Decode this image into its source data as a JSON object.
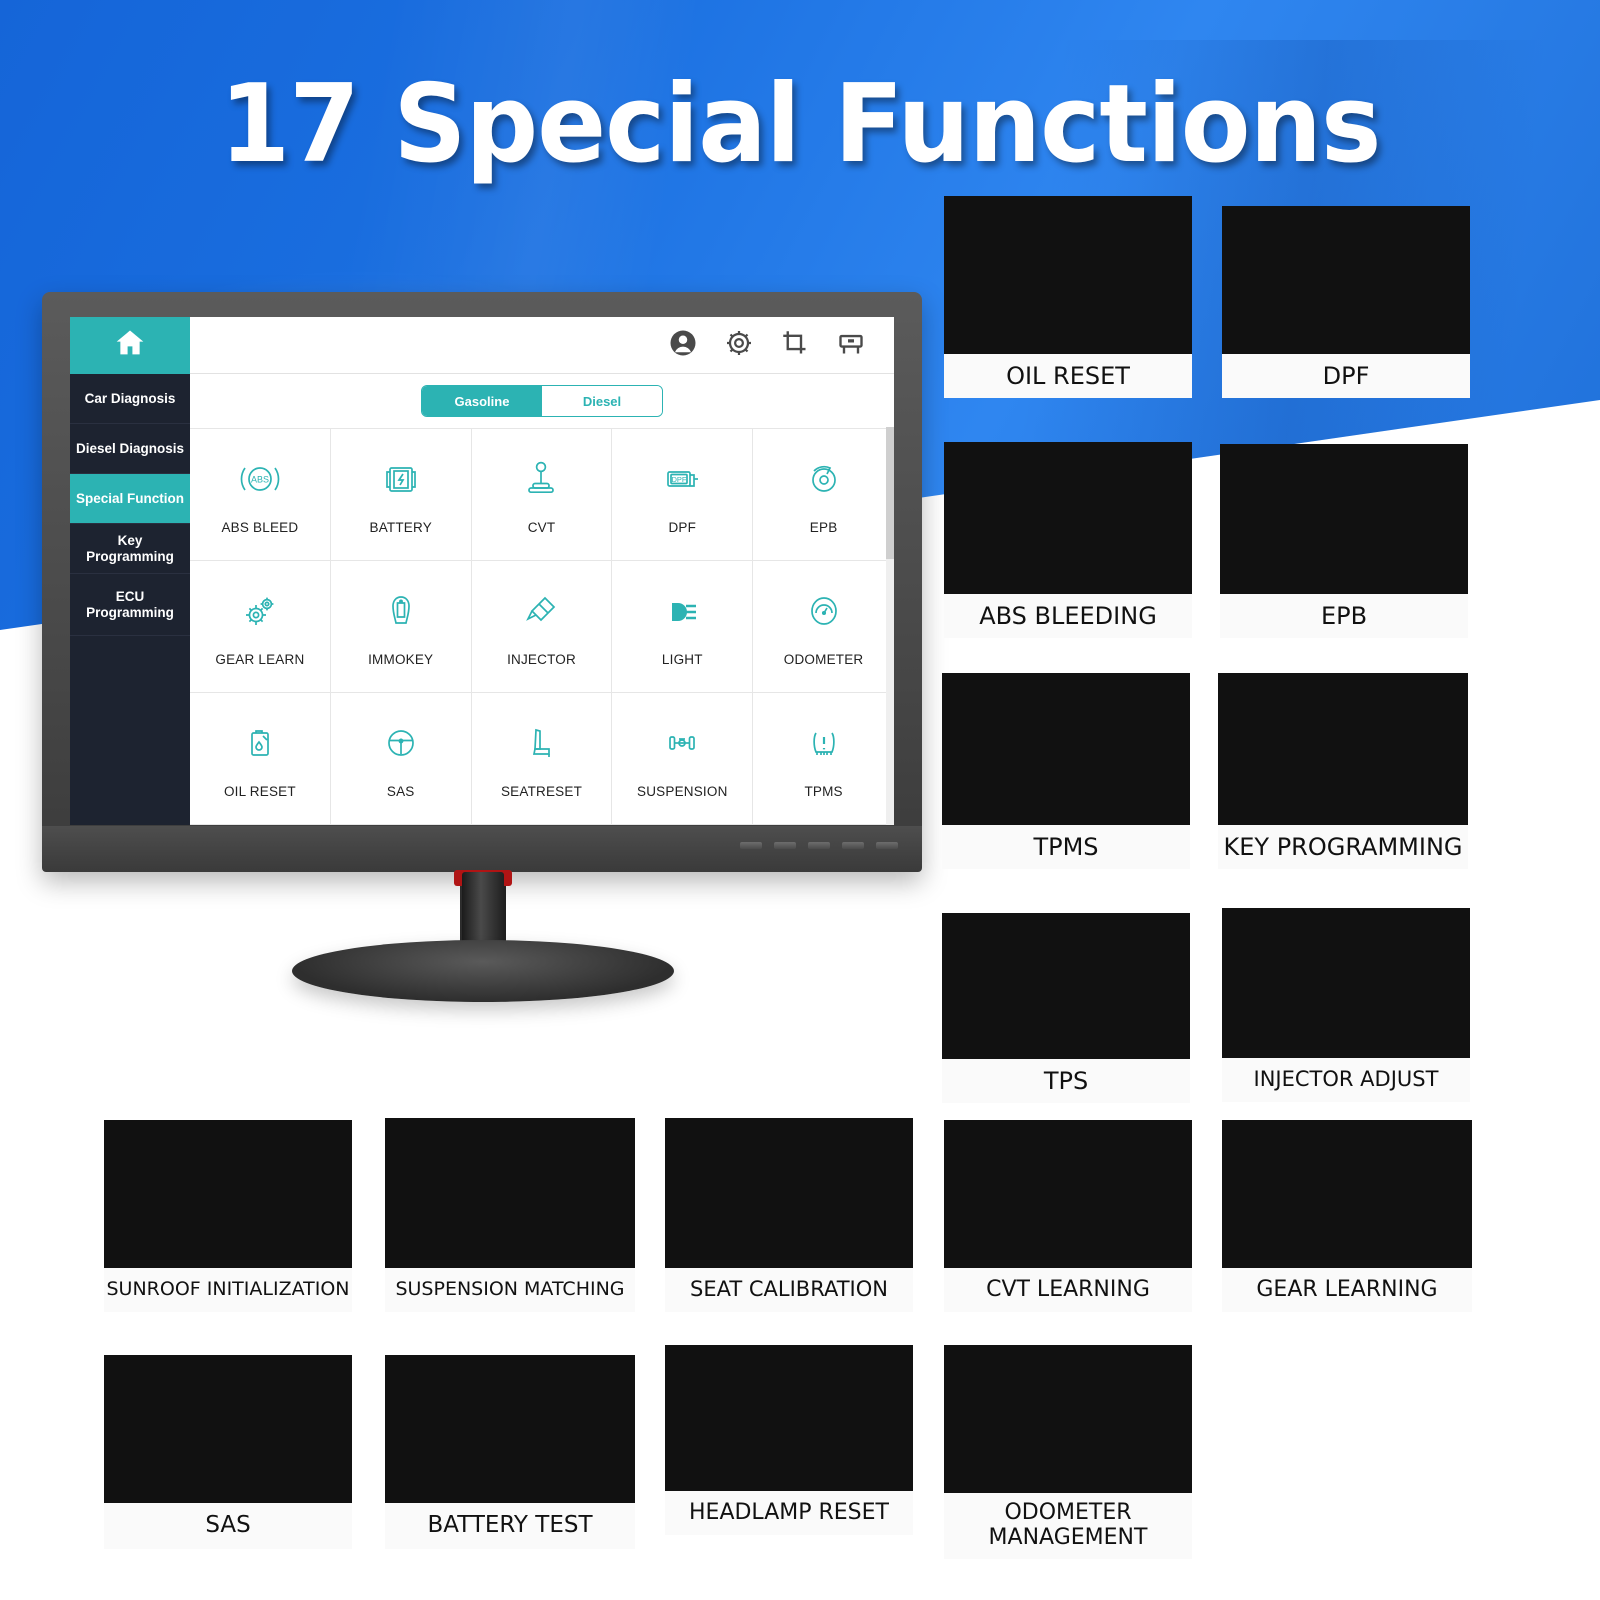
{
  "headline": "17 Special Functions",
  "device": {
    "app": {
      "sidebar": {
        "home_icon": "home-icon",
        "items": [
          {
            "label": "Car Diagnosis",
            "active": false
          },
          {
            "label": "Diesel Diagnosis",
            "active": false
          },
          {
            "label": "Special Function",
            "active": true
          },
          {
            "label": "Key Programming",
            "active": false
          },
          {
            "label": "ECU Programming",
            "active": false
          }
        ]
      },
      "toolbar": {
        "icons": [
          "account-icon",
          "gear-icon",
          "crop-icon",
          "printer-icon"
        ]
      },
      "fuel_tabs": {
        "options": [
          "Gasoline",
          "Diesel"
        ],
        "selected": "Gasoline"
      },
      "functions": [
        {
          "label": "ABS BLEED",
          "icon": "abs-icon"
        },
        {
          "label": "BATTERY",
          "icon": "battery-icon"
        },
        {
          "label": "CVT",
          "icon": "gearshift-icon"
        },
        {
          "label": "DPF",
          "icon": "dpf-filter-icon"
        },
        {
          "label": "EPB",
          "icon": "brake-disc-icon"
        },
        {
          "label": "GEAR LEARN",
          "icon": "gears-icon"
        },
        {
          "label": "IMMOKEY",
          "icon": "immobilizer-key-icon"
        },
        {
          "label": "INJECTOR",
          "icon": "injector-icon"
        },
        {
          "label": "LIGHT",
          "icon": "headlight-icon"
        },
        {
          "label": "ODOMETER",
          "icon": "gauge-icon"
        },
        {
          "label": "OIL RESET",
          "icon": "oil-can-icon"
        },
        {
          "label": "SAS",
          "icon": "steering-wheel-icon"
        },
        {
          "label": "SEATRESET",
          "icon": "car-seat-icon"
        },
        {
          "label": "SUSPENSION",
          "icon": "axle-icon"
        },
        {
          "label": "TPMS",
          "icon": "tire-pressure-icon"
        }
      ]
    },
    "accent_color": "#2cb3b3",
    "sidebar_color": "#1d2330"
  },
  "brand_blue": "#1a6fe0",
  "cards": {
    "right_column": [
      {
        "label": "OIL RESET",
        "art": "art-oil"
      },
      {
        "label": "DPF",
        "art": "art-dpf"
      },
      {
        "label": "ABS BLEEDING",
        "art": "art-abs"
      },
      {
        "label": "EPB",
        "art": "art-epb"
      },
      {
        "label": "TPMS",
        "art": "art-tpms"
      },
      {
        "label": "KEY PROGRAMMING",
        "art": "art-key"
      },
      {
        "label": "TPS",
        "art": "art-tps"
      },
      {
        "label": "INJECTOR ADJUST",
        "art": "art-inj"
      }
    ],
    "bottom_row_1": [
      {
        "label": "SUNROOF INITIALIZATION",
        "art": "art-sunroof"
      },
      {
        "label": "SUSPENSION MATCHING",
        "art": "art-susp"
      },
      {
        "label": "SEAT CALIBRATION",
        "art": "art-seat"
      },
      {
        "label": "CVT LEARNING",
        "art": "art-cvt"
      },
      {
        "label": "GEAR LEARNING",
        "art": "art-gear"
      }
    ],
    "bottom_row_2": [
      {
        "label": "SAS",
        "art": "art-sas"
      },
      {
        "label": "BATTERY TEST",
        "art": "art-batt"
      },
      {
        "label": "HEADLAMP RESET",
        "art": "art-head"
      },
      {
        "label": "ODOMETER MANAGEMENT",
        "art": "art-odo"
      }
    ]
  }
}
